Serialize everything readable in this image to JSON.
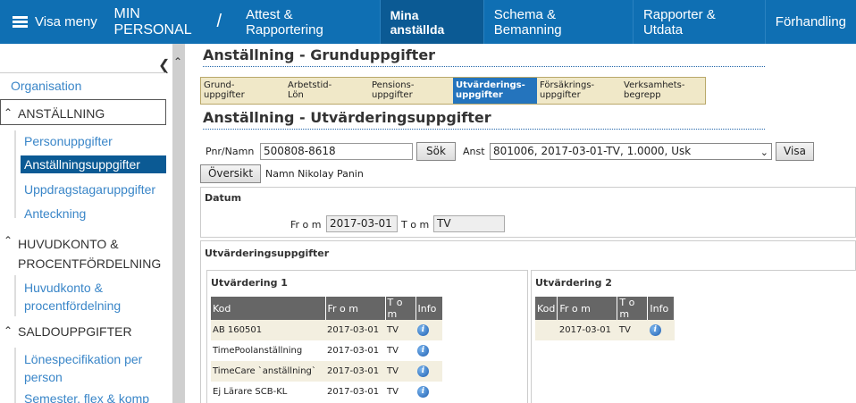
{
  "nav": {
    "menu_label": "Visa meny",
    "app_title": "MIN PERSONAL",
    "separator": "/",
    "tabs": [
      {
        "label": "Attest & Rapportering"
      },
      {
        "label": "Mina anställda"
      },
      {
        "label": "Schema & Bemanning"
      },
      {
        "label": "Rapporter & Utdata"
      },
      {
        "label": "Förhandling"
      }
    ],
    "active_tab": "Mina anställda",
    "colors": {
      "bar": "#0f6fb3",
      "active": "#0b5a94"
    }
  },
  "sidebar": {
    "collapse_icon": "chevron-left-icon",
    "items": [
      {
        "label": "Organisation"
      },
      {
        "label": "ANSTÄLLNING"
      },
      {
        "label": "Personuppgifter"
      },
      {
        "label": "Anställningsuppgifter"
      },
      {
        "label": "Uppdragstagaruppgifter"
      },
      {
        "label": "Anteckning"
      },
      {
        "label": "HUVUDKONTO &"
      },
      {
        "label": "PROCENTFÖRDELNING"
      },
      {
        "label": "Huvudkonto &"
      },
      {
        "label": "procentfördelning"
      },
      {
        "label": "SALDOUPPGIFTER"
      },
      {
        "label": "Lönespecifikation per"
      },
      {
        "label": "person"
      },
      {
        "label": "Semester, flex & komp"
      }
    ]
  },
  "main": {
    "title1": "Anställning - Grunduppgifter",
    "subtabs": [
      {
        "l1": "Grund-",
        "l2": "uppgifter"
      },
      {
        "l1": "Arbetstid-",
        "l2": "Lön"
      },
      {
        "l1": "Pensions-",
        "l2": "uppgifter"
      },
      {
        "l1": "Utvärderings-",
        "l2": "uppgifter"
      },
      {
        "l1": "Försäkrings-",
        "l2": "uppgifter"
      },
      {
        "l1": "Verksamhets-",
        "l2": "begrepp"
      }
    ],
    "title2": "Anställning - Utvärderingsuppgifter",
    "pnr_label": "Pnr/Namn",
    "pnr_value": "500808-8618",
    "search_button": "Sök",
    "anst_label": "Anst",
    "anst_value": "801006, 2017-03-01-TV, 1.0000, Usk",
    "show_button": "Visa",
    "overview_button": "Översikt",
    "name_text": "Namn Nikolay Panin",
    "date_section": "Datum",
    "from_label": "Fr o m",
    "from_value": "2017-03-01",
    "to_label": "T o m",
    "to_value": "TV",
    "eval_section": "Utvärderingsuppgifter",
    "eval1": {
      "title": "Utvärdering 1",
      "headers": {
        "kod": "Kod",
        "from": "Fr o m",
        "tom": "T o m",
        "info": "Info"
      },
      "rows": [
        {
          "kod": "AB 160501",
          "from": "2017-03-01",
          "tom": "TV"
        },
        {
          "kod": "TimePoolanställning",
          "from": "2017-03-01",
          "tom": "TV"
        },
        {
          "kod": "TimeCare `anställning`",
          "from": "2017-03-01",
          "tom": "TV"
        },
        {
          "kod": "Ej Lärare SCB-KL",
          "from": "2017-03-01",
          "tom": "TV"
        }
      ]
    },
    "eval2": {
      "title": "Utvärdering 2",
      "headers": {
        "kod": "Kod",
        "from": "Fr o m",
        "tom": "T o m",
        "info": "Info"
      },
      "rows": [
        {
          "kod": "",
          "from": "2017-03-01",
          "tom": "TV"
        }
      ]
    },
    "info_icon": "info-icon"
  }
}
